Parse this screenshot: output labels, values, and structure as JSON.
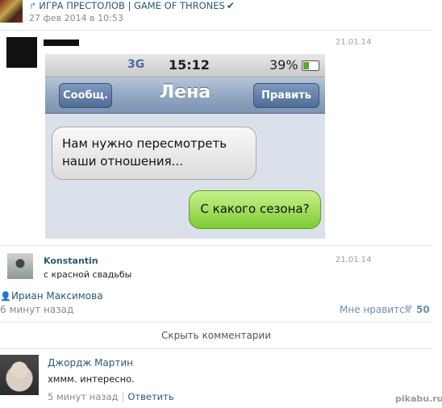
{
  "post": {
    "group_name": "ИГРА ПРЕСТОЛОВ | GAME OF THRONES",
    "share_icon": "share-arrow-icon",
    "verified_icon": "checkmark-icon",
    "date": "27 фев 2014 в 10:53"
  },
  "repost": {
    "date": "21.01.14"
  },
  "phone": {
    "network": "3G",
    "time": "15:12",
    "battery": "39%",
    "back_label": "Сообщ.",
    "contact": "Лена",
    "edit_label": "Править",
    "incoming_line1": "Нам нужно пересмотреть",
    "incoming_line2": "наши отношения...",
    "outgoing": "С какого сезона?"
  },
  "comment1": {
    "author": "Konstantin",
    "text": "с красной свадьбы",
    "date": "21.01.14"
  },
  "likes": {
    "user": "Ириан Максимова",
    "time_ago": "6 минут назад",
    "label": "Мне нравится",
    "count": "50"
  },
  "hide_comments": "Скрыть комментарии",
  "comment2": {
    "author": "Джордж Мартин",
    "text": "хммм. интересно.",
    "time_ago": "5 минут назад",
    "separator": "|",
    "reply": "Ответить"
  },
  "watermark": "pikabu.ru",
  "colors": {
    "link": "#2b587a",
    "bubble_green": "#7dcb34",
    "nav_blue": "#8fa5c0"
  }
}
